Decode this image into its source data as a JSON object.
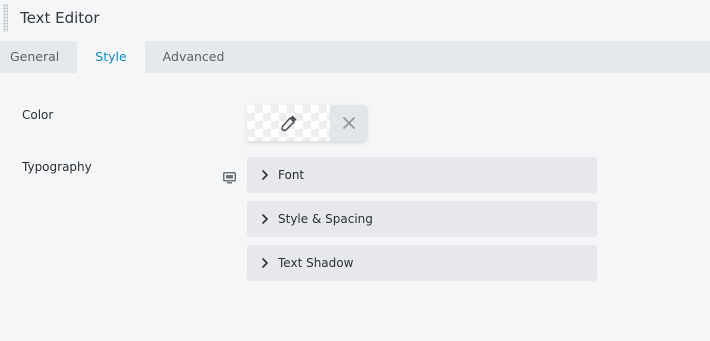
{
  "panel": {
    "title": "Text Editor"
  },
  "tabs": [
    {
      "label": "General",
      "active": false
    },
    {
      "label": "Style",
      "active": true
    },
    {
      "label": "Advanced",
      "active": false
    }
  ],
  "fields": {
    "color": {
      "label": "Color",
      "icons": [
        "eyedropper-icon",
        "close-icon"
      ]
    },
    "typography": {
      "label": "Typography",
      "device_icon": "desktop-icon",
      "sections": [
        {
          "label": "Font"
        },
        {
          "label": "Style & Spacing"
        },
        {
          "label": "Text Shadow"
        }
      ]
    }
  },
  "colors": {
    "accent": "#1985bd",
    "tab_bar": "#e6e9ec",
    "background": "#f5f6f7",
    "accordion": "#e6e8eb"
  }
}
